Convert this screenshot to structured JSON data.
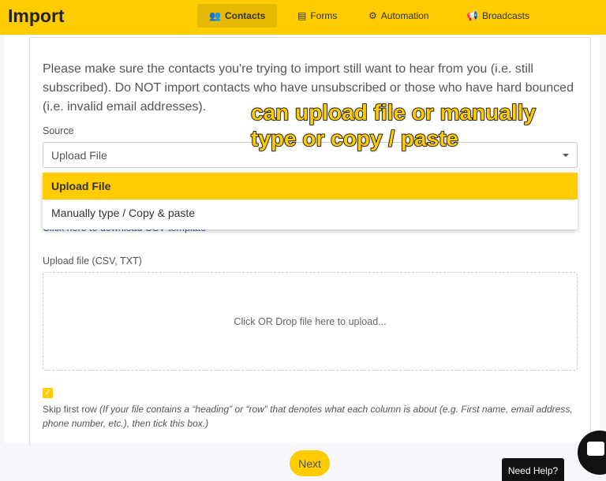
{
  "header": {
    "title": "Import",
    "nav": [
      {
        "label": "Contacts",
        "icon": "users-icon",
        "active": true
      },
      {
        "label": "Forms",
        "icon": "form-icon"
      },
      {
        "label": "Automation",
        "icon": "gears-icon"
      },
      {
        "label": "Broadcasts",
        "icon": "megaphone-icon"
      }
    ]
  },
  "intro": "Please make sure the contacts you're trying to import still want to hear from you (i.e. still subscribed). Do NOT import contacts who have unsubscribed or those who have hard bounced (i.e. invalid email addresses).",
  "source": {
    "label": "Source",
    "value": "Upload File",
    "options": [
      "Upload File",
      "Manually type / Copy & paste"
    ]
  },
  "template_link": "Click here to download CSV template",
  "upload": {
    "label": "Upload file (CSV, TXT)",
    "placeholder": "Click OR Drop file here to upload..."
  },
  "skip": {
    "checked": true,
    "label": "Skip first row",
    "hint": "(If your file contains a “heading” or “row” that denotes what each column is about (e.g. First name, email address, phone number, etc.), then tick this box.)"
  },
  "annotation": {
    "line1": "can upload file or manually",
    "line2": "type or copy / paste"
  },
  "footer": {
    "next": "Next",
    "help": "Need Help?"
  },
  "colors": {
    "accent": "#ffcc00"
  }
}
